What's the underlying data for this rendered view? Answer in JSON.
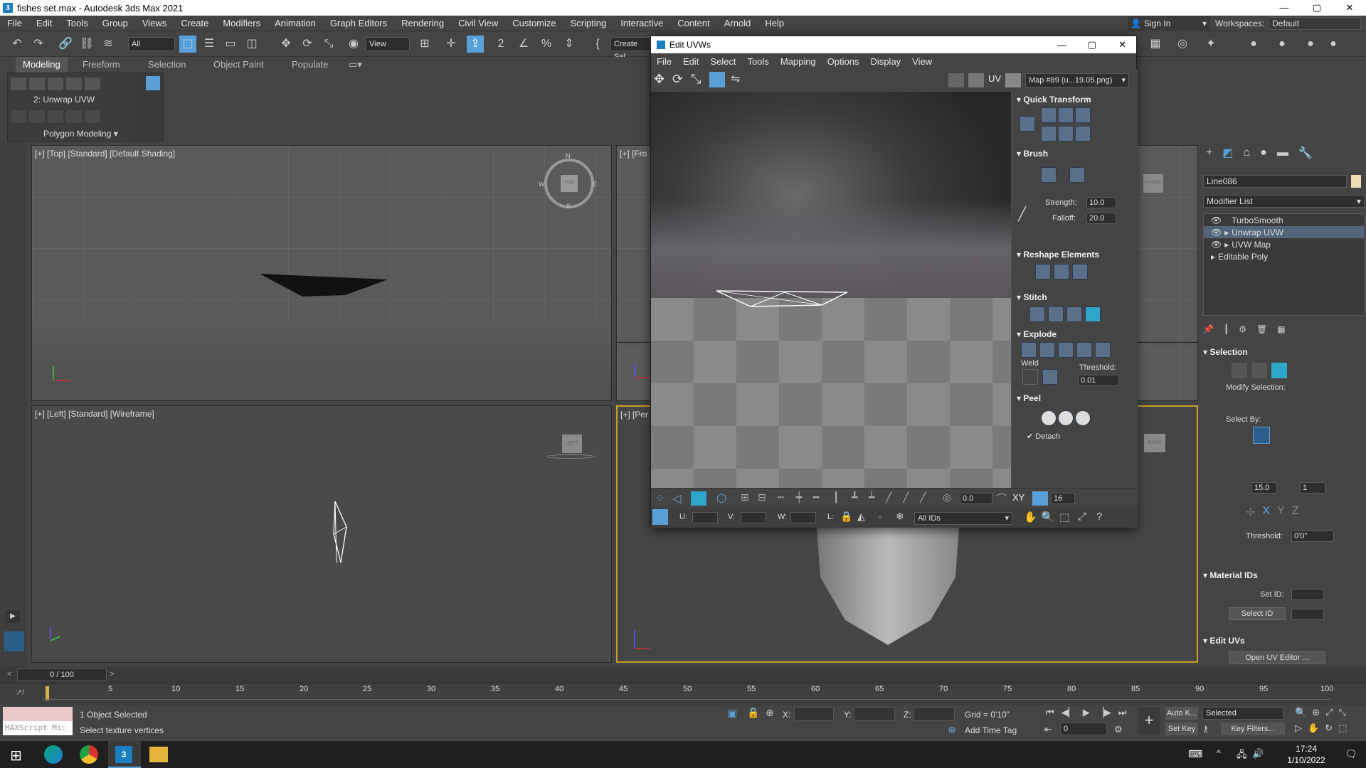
{
  "window": {
    "title": "fishes set.max - Autodesk 3ds Max 2021",
    "minimize": "—",
    "maximize": "▢",
    "close": "✕"
  },
  "menu": [
    "File",
    "Edit",
    "Tools",
    "Group",
    "Views",
    "Create",
    "Modifiers",
    "Animation",
    "Graph Editors",
    "Rendering",
    "Civil View",
    "Customize",
    "Scripting",
    "Interactive",
    "Content",
    "Arnold",
    "Help"
  ],
  "signin": "Sign In",
  "workspace": {
    "label": "Workspaces:",
    "value": "Default"
  },
  "toolbar": {
    "filter": "All",
    "view": "View",
    "create_sel": "Create Sel"
  },
  "ribbon_tabs": [
    "Modeling",
    "Freeform",
    "Selection",
    "Object Paint",
    "Populate"
  ],
  "ribbon": {
    "modifier": "2: Unwrap UVW",
    "group": "Polygon Modeling"
  },
  "viewports": {
    "top": "[+] [Top] [Standard] [Default Shading]",
    "front": "[+] [Fro",
    "left": "[+] [Left] [Standard] [Wireframe]",
    "persp": "[+] [Per",
    "compass": {
      "n": "N",
      "s": "S",
      "w": "W",
      "e": "E",
      "cube": "TOP"
    },
    "left_cube": "LEFT",
    "front_cube": "FRONT",
    "back_cube": "BACK"
  },
  "uvw": {
    "title": "Edit UVWs",
    "menu": [
      "File",
      "Edit",
      "Select",
      "Tools",
      "Mapping",
      "Options",
      "Display",
      "View"
    ],
    "uv_label": "UV",
    "map": "Map #89 (u...19.05.png)",
    "sections": {
      "quick_transform": "Quick Transform",
      "brush": "Brush",
      "strength_label": "Strength:",
      "strength": "10.0",
      "falloff_label": "Falloff:",
      "falloff": "20.0",
      "reshape": "Reshape Elements",
      "stitch": "Stitch",
      "explode": "Explode",
      "weld": "Weld",
      "threshold_label": "Threshold:",
      "threshold": "0.01",
      "peel": "Peel",
      "detach": "Detach"
    },
    "bottom": {
      "angle": "0.0",
      "xy": "XY",
      "count": "16",
      "u_label": "U:",
      "v_label": "V:",
      "w_label": "W:",
      "l_label": "L:",
      "ids": "All IDs"
    }
  },
  "cmd": {
    "object_name": "Line086",
    "modifier_list": "Modifier List",
    "stack": [
      "TurboSmooth",
      "Unwrap UVW",
      "UVW Map",
      "Editable Poly"
    ],
    "selection": "Selection",
    "modify_selection": "Modify Selection:",
    "select_by": "Select By:",
    "angle": "15.0",
    "one": "1",
    "threshold_label": "Threshold:",
    "threshold": "0'0\"",
    "material_ids": "Material IDs",
    "set_id": "Set ID:",
    "select_id": "Select ID",
    "edit_uvs": "Edit UVs",
    "open_uv_editor": "Open UV Editor ..."
  },
  "timeline": {
    "frame": "0 / 100",
    "ticks": [
      "5",
      "10",
      "15",
      "20",
      "25",
      "30",
      "35",
      "40",
      "45",
      "50",
      "55",
      "60",
      "65",
      "70",
      "75",
      "80",
      "85",
      "90",
      "95",
      "100"
    ]
  },
  "status": {
    "maxscript": "MAXScript Mi:",
    "objects": "1 Object Selected",
    "hint": "Select texture vertices",
    "x_label": "X:",
    "y_label": "Y:",
    "z_label": "Z:",
    "grid": "Grid = 0'10\"",
    "add_time_tag": "Add Time Tag",
    "auto_key": "Auto K...",
    "selected": "Selected",
    "set_key": "Set Key",
    "key_filters": "Key Filters...",
    "frame_value": "0"
  },
  "taskbar": {
    "time": "17:24",
    "date": "1/10/2022"
  },
  "colors": {
    "accent": "#5aa0d8",
    "viewport_bg": "#5a5a5a",
    "selected_mod": "#54647a"
  }
}
